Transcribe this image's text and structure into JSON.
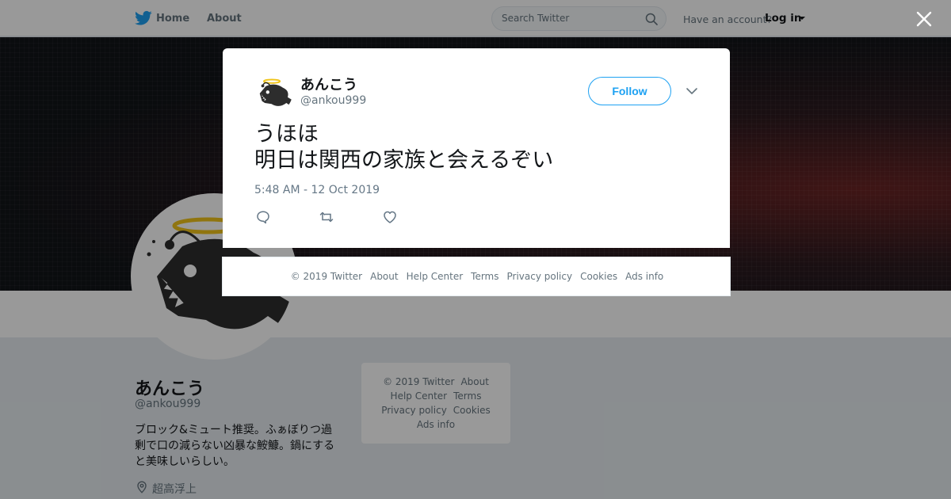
{
  "nav": {
    "home": "Home",
    "about": "About",
    "search_placeholder": "Search Twitter",
    "have_account": "Have an account?",
    "login": "Log in"
  },
  "profile": {
    "name": "あんこう",
    "handle": "@ankou999",
    "bio": "ブロック&ミュート推奨。ふぁぼりつ過剰で口の減らない凶暴な鮟鱇。鍋にすると美味しいらしい。",
    "location": "超高浮上"
  },
  "side_footer": {
    "copyright": "© 2019 Twitter",
    "about": "About",
    "help": "Help Center",
    "terms": "Terms",
    "privacy": "Privacy policy",
    "cookies": "Cookies",
    "ads": "Ads info"
  },
  "tweet": {
    "name": "あんこう",
    "handle": "@ankou999",
    "follow": "Follow",
    "text_line1": "うほほ",
    "text_line2": "明日は関西の家族と会えるぞい",
    "timestamp": "5:48 AM - 12 Oct 2019"
  },
  "modal_footer": {
    "copyright": "© 2019 Twitter",
    "about": "About",
    "help": "Help Center",
    "terms": "Terms",
    "privacy": "Privacy policy",
    "cookies": "Cookies",
    "ads": "Ads info"
  },
  "colors": {
    "accent": "#1da1f2",
    "muted": "#66757f",
    "text": "#14171a"
  }
}
